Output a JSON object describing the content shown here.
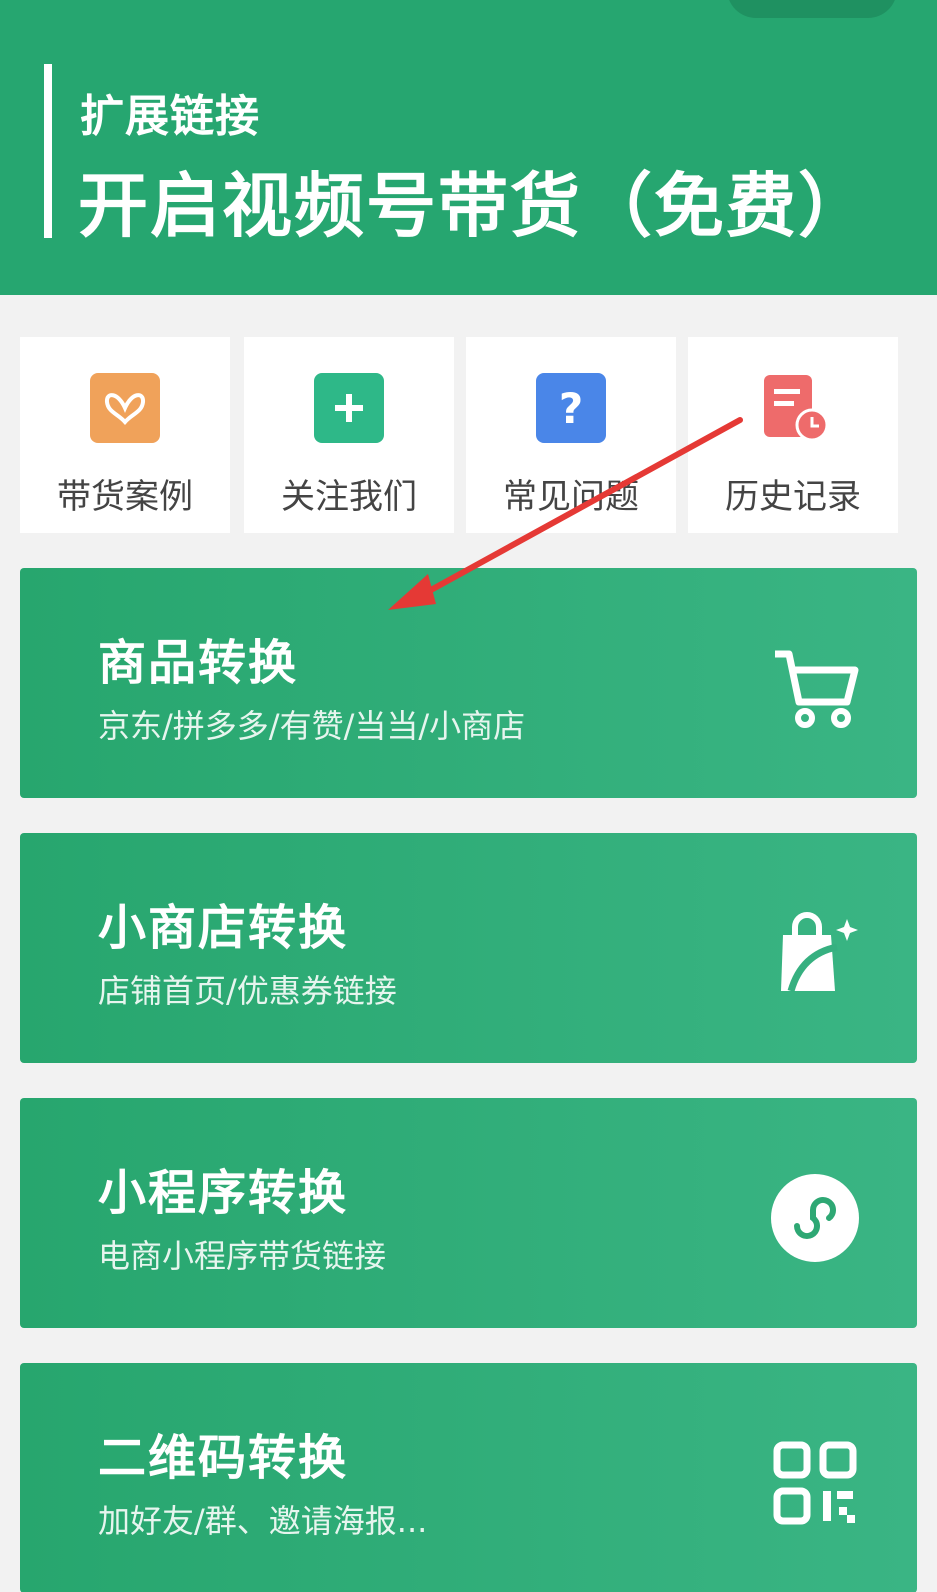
{
  "header": {
    "subtitle": "扩展链接",
    "title": "开启视频号带货（免费）"
  },
  "quick_actions": [
    {
      "label": "带货案例",
      "icon": "butterfly-icon",
      "color": "#f0a25a"
    },
    {
      "label": "关注我们",
      "icon": "plus-icon",
      "color": "#2eb888"
    },
    {
      "label": "常见问题",
      "icon": "question-icon",
      "color": "#4a86e8"
    },
    {
      "label": "历史记录",
      "icon": "history-icon",
      "color": "#ee6b6b"
    }
  ],
  "cards": [
    {
      "title": "商品转换",
      "subtitle": "京东/拼多多/有赞/当当/小商店",
      "icon": "cart-icon"
    },
    {
      "title": "小商店转换",
      "subtitle": "店铺首页/优惠券链接",
      "icon": "shopping-bag-icon"
    },
    {
      "title": "小程序转换",
      "subtitle": "电商小程序带货链接",
      "icon": "mini-program-icon"
    },
    {
      "title": "二维码转换",
      "subtitle": "加好友/群、邀请海报...",
      "icon": "qrcode-icon"
    }
  ],
  "colors": {
    "brand_green": "#26a670",
    "annotation_arrow": "#e53935"
  }
}
